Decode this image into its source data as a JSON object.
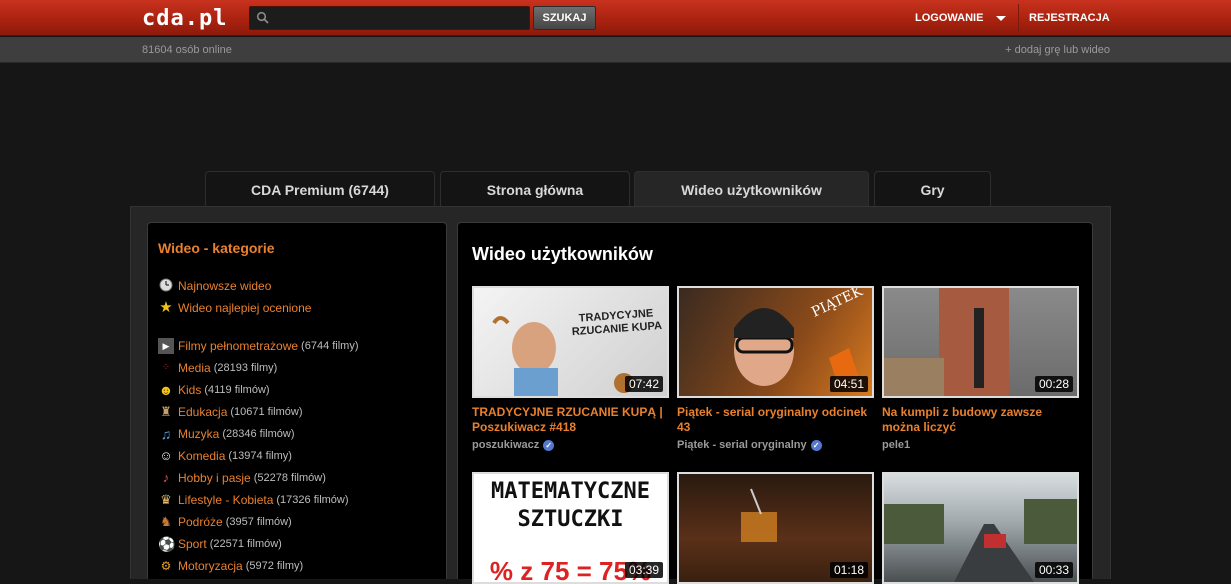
{
  "header": {
    "logo": "cda.pl",
    "search_placeholder": "",
    "search_button": "SZUKAJ",
    "login": "LOGOWANIE",
    "register": "REJESTRACJA"
  },
  "subbar": {
    "online": "81604 osób online",
    "add_link": "+ dodaj grę lub wideo"
  },
  "tabs": [
    {
      "label": "CDA Premium (6744)"
    },
    {
      "label": "Strona główna"
    },
    {
      "label": "Wideo użytkowników"
    },
    {
      "label": "Gry"
    }
  ],
  "sidebar": {
    "title": "Wideo - kategorie",
    "quick": [
      {
        "label": "Najnowsze wideo",
        "icon": "clock-icon"
      },
      {
        "label": "Wideo najlepiej ocenione",
        "icon": "star-icon"
      }
    ],
    "categories": [
      {
        "label": "Filmy pełnometrażowe",
        "count": "(6744 filmy)",
        "icon": "film-icon"
      },
      {
        "label": "Media",
        "count": "(28193 filmy)",
        "icon": "media-icon"
      },
      {
        "label": "Kids",
        "count": "(4119 filmów)",
        "icon": "smiley-icon"
      },
      {
        "label": "Edukacja",
        "count": "(10671 filmów)",
        "icon": "education-icon"
      },
      {
        "label": "Muzyka",
        "count": "(28346 filmów)",
        "icon": "music-icon"
      },
      {
        "label": "Komedia",
        "count": "(13974 filmy)",
        "icon": "comedy-mask-icon"
      },
      {
        "label": "Hobby i pasje",
        "count": "(52278 filmów)",
        "icon": "guitar-icon"
      },
      {
        "label": "Lifestyle - Kobieta",
        "count": "(17326 filmów)",
        "icon": "woman-icon"
      },
      {
        "label": "Podróże",
        "count": "(3957 filmów)",
        "icon": "travel-icon"
      },
      {
        "label": "Sport",
        "count": "(22571 filmów)",
        "icon": "soccer-ball-icon"
      },
      {
        "label": "Motoryzacja",
        "count": "(5972 filmy)",
        "icon": "car-icon"
      }
    ]
  },
  "content": {
    "title": "Wideo użytkowników",
    "videos": [
      {
        "title": "TRADYCYJNE RZUCANIE KUPĄ | Poszukiwacz #418",
        "author": "poszukiwacz",
        "verified": true,
        "duration": "07:42",
        "thumb_text": "TRADYCYJNE RZUCANIE KUPA"
      },
      {
        "title": "Piątek - serial oryginalny odcinek 43",
        "author": "Piątek - serial oryginalny",
        "verified": true,
        "duration": "04:51",
        "thumb_text": "PIĄTEK"
      },
      {
        "title": "Na kumpli z budowy zawsze można liczyć",
        "author": "pele1",
        "verified": false,
        "duration": "00:28",
        "thumb_text": ""
      },
      {
        "title": "",
        "author": "",
        "verified": false,
        "duration": "03:39",
        "thumb_text": "MATEMATYCZNE SZTUCZKI"
      },
      {
        "title": "",
        "author": "",
        "verified": false,
        "duration": "01:18",
        "thumb_text": ""
      },
      {
        "title": "",
        "author": "",
        "verified": false,
        "duration": "00:33",
        "thumb_text": ""
      }
    ]
  },
  "colors": {
    "brand_red": "#b8281a",
    "accent_orange": "#e9802d",
    "background": "#161616"
  }
}
